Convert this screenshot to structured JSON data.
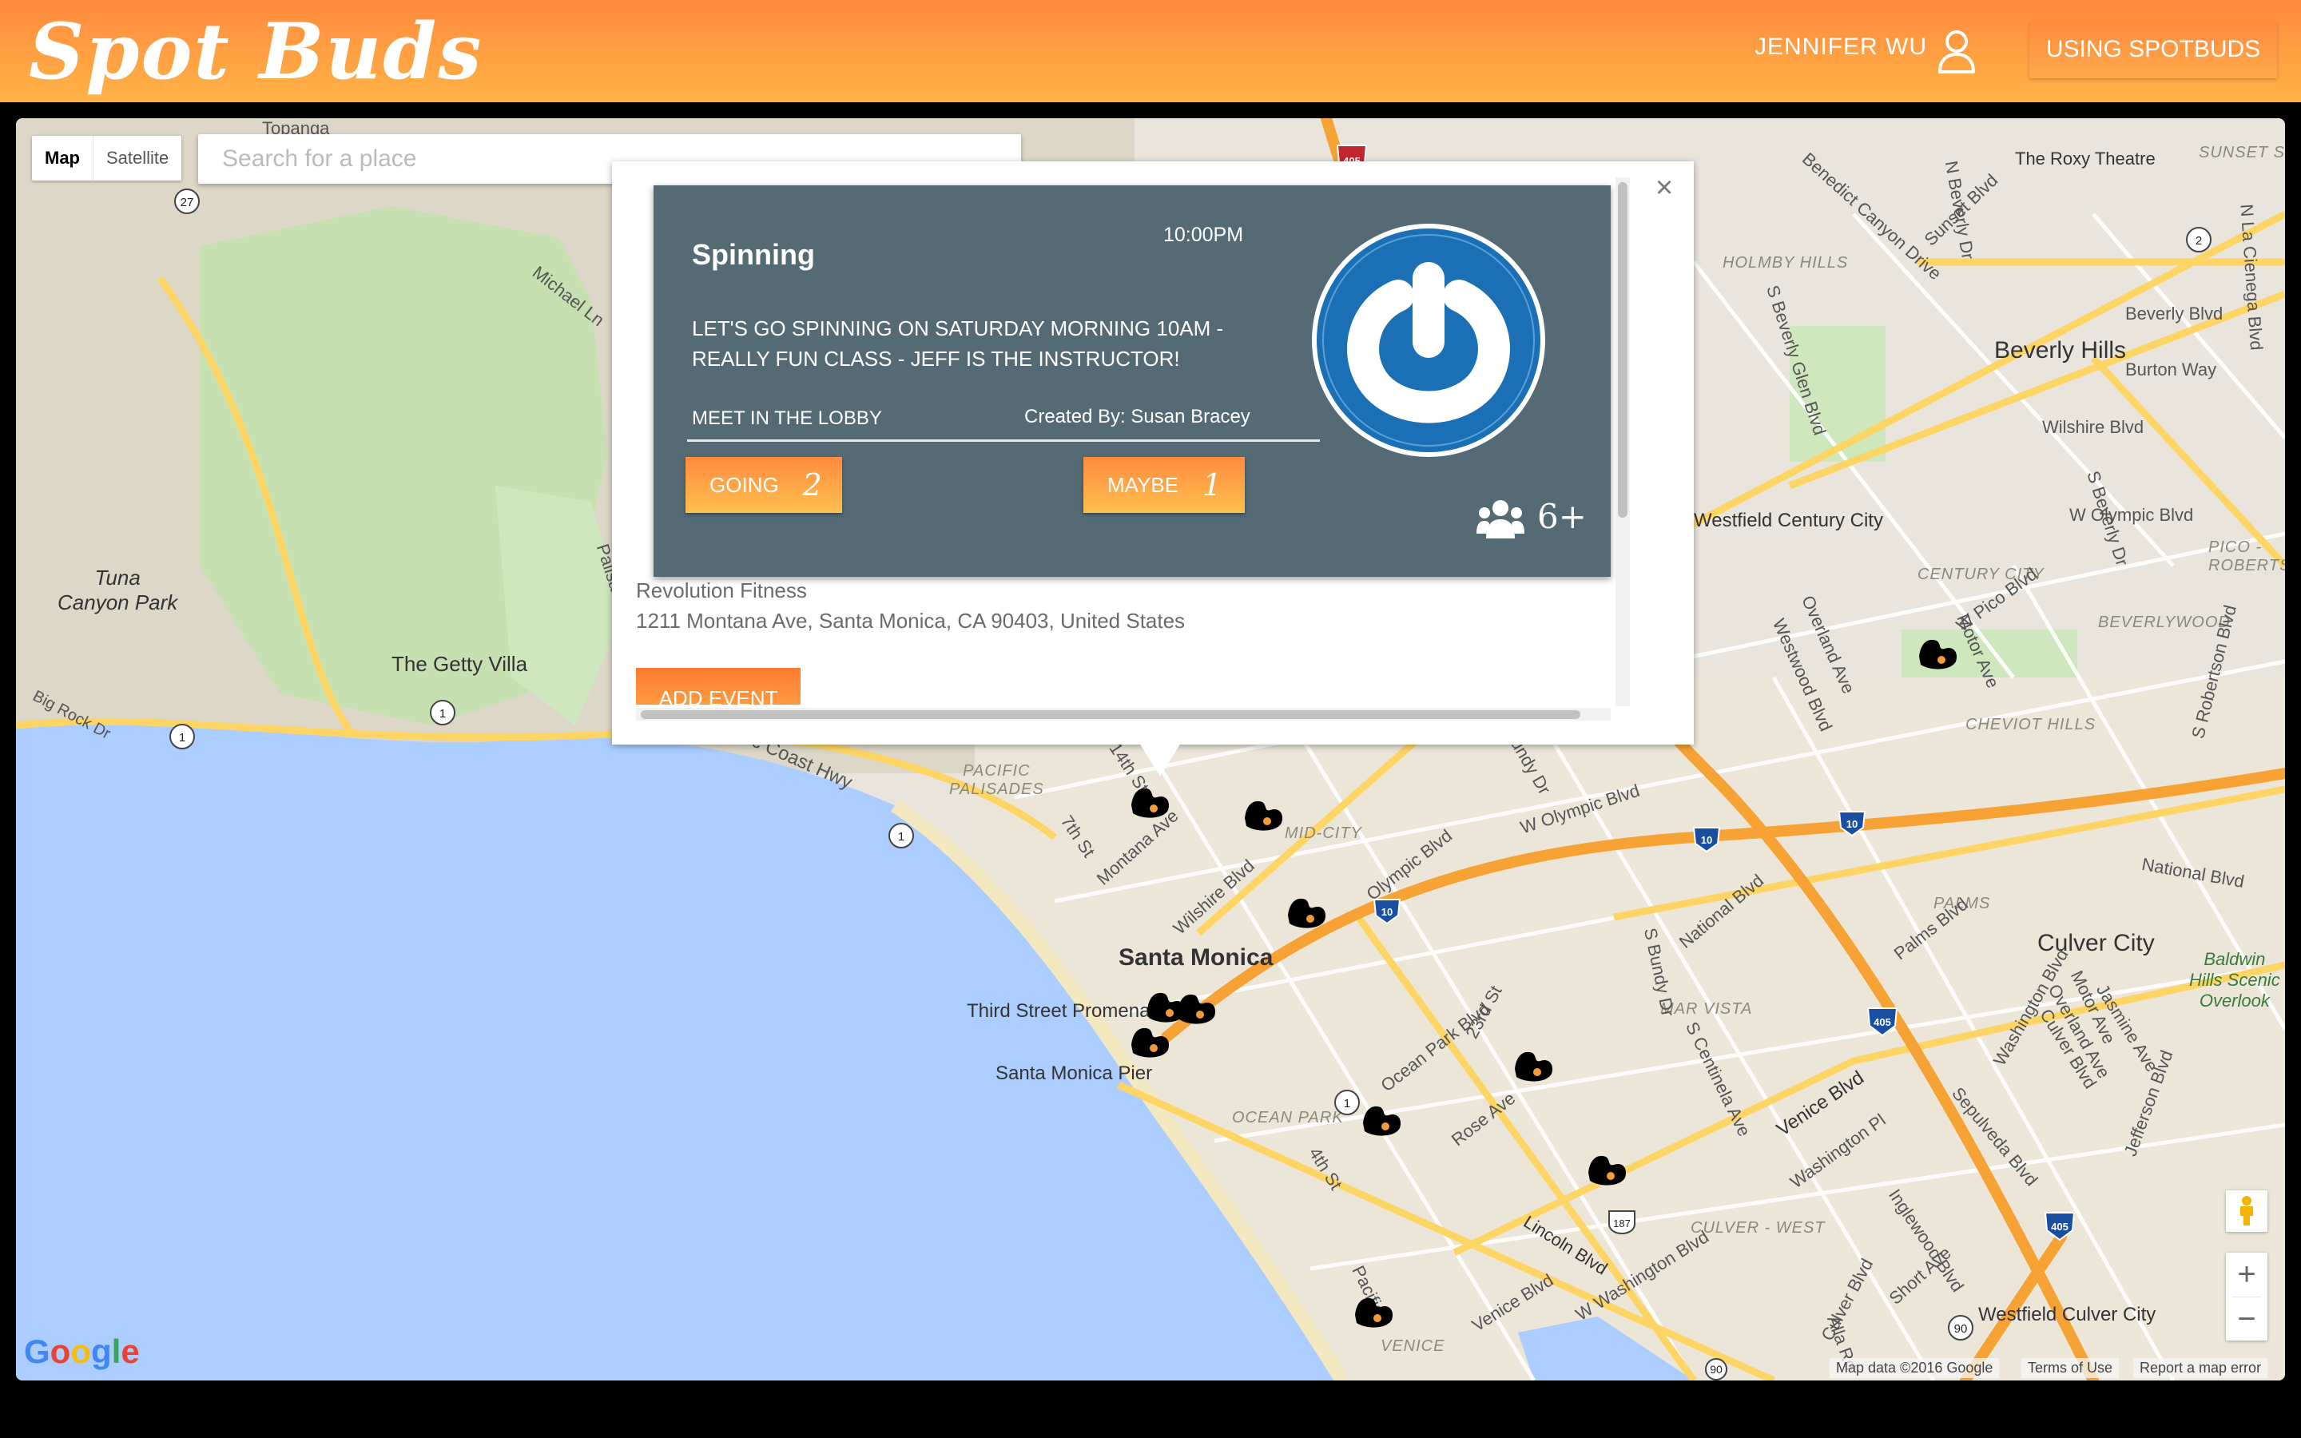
{
  "header": {
    "logo": "Spot Buds",
    "user_name": "JENNIFER WU",
    "using_button": "USING SPOTBUDS"
  },
  "map_controls": {
    "map_type_map": "Map",
    "map_type_satellite": "Satellite",
    "search_placeholder": "Search for a place",
    "zoom_in": "+",
    "zoom_out": "−"
  },
  "map_labels": {
    "topanga": "Topanga",
    "michael_ln": "Michael Ln",
    "palisades_dr": "Palisades Dr",
    "tuna_canyon_park": "Tuna\nCanyon Park",
    "getty_villa": "The Getty Villa",
    "big_rock_dr": "Big Rock Dr",
    "pacific_palisades": "PACIFIC\nPALISADES",
    "santa_monica": "Santa Monica",
    "third_street": "Third Street Promenade",
    "santa_monica_pier": "Santa Monica Pier",
    "mid_city": "MID-CITY",
    "ocean_park": "OCEAN PARK",
    "montana_ave": "Montana Ave",
    "wilshire_blvd_sm": "Wilshire Blvd",
    "olympic_blvd": "Olympic Blvd",
    "seventh_st": "7th St",
    "fourteenth_st": "14th St",
    "ocean_park_blvd": "Ocean Park Blvd",
    "rose_ave": "Rose Ave",
    "twenty_third_st": "23rd St",
    "fourth_st": "4th St",
    "lincoln_blvd": "Lincoln Blvd",
    "venice_blvd": "Venice Blvd",
    "w_washington_blvd": "W Washington Blvd",
    "venice": "VENICE",
    "pacific": "Pacific",
    "mar_vista": "MAR VISTA",
    "culver_west": "CULVER - WEST",
    "palms": "PALMS",
    "culver_city": "Culver City",
    "baldwin_hills": "Baldwin\nHills Scenic\nOverlook",
    "national_blvd": "National Blvd",
    "national_blvd_e": "National Blvd",
    "w_olympic_blvd": "W Olympic Blvd",
    "w_olympic_blvd_e": "W Olympic Blvd",
    "bundy_dr": "Bundy Dr",
    "s_bundy_dr": "S Bundy Dr",
    "s_centinela_ave": "S Centinela Ave",
    "washington_pl": "Washington Pl",
    "sepulveda_blvd": "Sepulveda Blvd",
    "jefferson_blvd": "Jefferson Blvd",
    "overland_ave": "Overland Ave",
    "inglewood_blvd": "Inglewood Blvd",
    "palms_blvd": "Palms Blvd",
    "washington_blvd": "Washington Blvd",
    "westfield_culver": "Westfield Culver City",
    "westfield_century": "Westfield Century City",
    "century_city": "CENTURY CITY",
    "beverlywood": "BEVERLYWOOD",
    "cheviot_hills": "CHEVIOT HILLS",
    "pico_robertson": "PICO -\nROBERTSON",
    "w_pico_blvd": "W Pico Blvd",
    "motor_ave": "Motor Ave",
    "beverly_hills": "Beverly Hills",
    "holmby_hills": "HOLMBY HILLS",
    "roxy": "The Roxy Theatre",
    "sunset_st": "SUNSET ST",
    "wilshire_blvd_bh": "Wilshire Blvd",
    "beverly_blvd": "Beverly Blvd",
    "burton_way": "Burton Way",
    "s_robertson_blvd": "S Robertson Blvd",
    "westwood_blvd": "Westwood Blvd",
    "overland_ave_n": "Overland Ave",
    "s_beverly_dr": "S Beverly Dr",
    "sunset_blvd": "Sunset Blvd",
    "benedict_canyon": "Benedict Canyon Drive",
    "n_beverly_dr": "N Beverly Dr",
    "s_beverly_glen": "S Beverly Glen Blvd",
    "short_ave": "Short Ave",
    "alla_rd": "Alla Rd",
    "culver_blvd": "Culver Blvd",
    "venice_blvd_w": "Venice Blvd",
    "la_cienega": "N La Cienega Blvd",
    "pacific_coast_hwy": "Pacific Coast Hwy",
    "jasmine_ave": "Jasmine Ave",
    "motor_ave_s": "Motor Ave",
    "culver_blvd_n": "Culver Blvd",
    "overland_ave_s": "Overland Ave"
  },
  "highway_shields": [
    "405",
    "27",
    "1",
    "1",
    "1",
    "1",
    "10",
    "10",
    "10",
    "405",
    "405",
    "2",
    "187",
    "90",
    "90"
  ],
  "map_footer": {
    "map_data": "Map data ©2016 Google",
    "terms": "Terms of Use",
    "report": "Report a map error",
    "google": "Google"
  },
  "event": {
    "title": "Spinning",
    "time": "10:00PM",
    "description": "LET'S GO SPINNING ON SATURDAY MORNING 10AM - REALLY FUN CLASS - JEFF IS THE INSTRUCTOR!",
    "meeting_point": "MEET IN THE LOBBY",
    "created_by": "Created By: Susan Bracey",
    "going_label": "GOING",
    "going_count": "2",
    "maybe_label": "MAYBE",
    "maybe_count": "1",
    "attendee_count": "6+",
    "venue_name": "Revolution Fitness",
    "venue_address": "1211 Montana Ave, Santa Monica, CA 90403, United States",
    "add_event": "ADD EVENT",
    "close": "×"
  },
  "colors": {
    "header_start": "#ff8a3d",
    "header_end": "#ffb347",
    "card_bg": "#546b75",
    "ocean": "#abcdff",
    "land": "#e9e5dc",
    "park": "#cfe7bd",
    "freeway": "#f7a234",
    "logo_blue": "#1a6fb5"
  }
}
